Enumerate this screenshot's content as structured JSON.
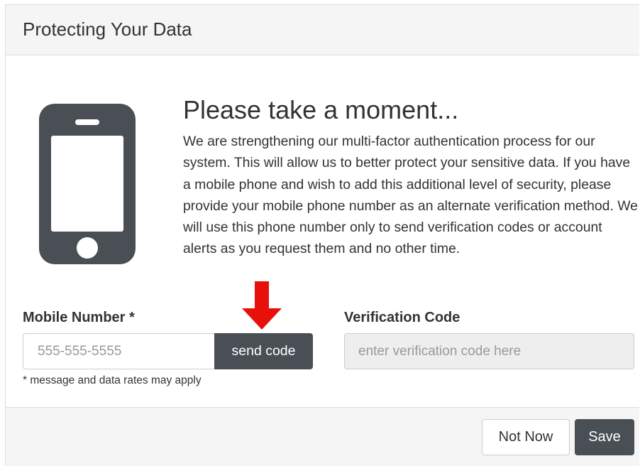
{
  "panel": {
    "title": "Protecting Your Data"
  },
  "content": {
    "icon": "mobile-phone-icon",
    "heading": "Please take a moment...",
    "body": "We are strengthening our multi-factor authentication process for our system. This will allow us to better protect your sensitive data. If you have a mobile phone and wish to add this additional level of security, please provide your mobile phone number as an alternate verification method. We will use this phone number only to send verification codes or account alerts as you request them and no other time."
  },
  "form": {
    "mobile_label": "Mobile Number *",
    "mobile_value": "",
    "mobile_placeholder": "555-555-5555",
    "send_code_label": "send code",
    "rates_note": "* message and data rates may apply",
    "verification_label": "Verification Code",
    "verification_value": "",
    "verification_placeholder": "enter verification code here",
    "annotation_icon": "red-down-arrow-icon"
  },
  "footer": {
    "not_now_label": "Not Now",
    "save_label": "Save"
  },
  "colors": {
    "dark_button": "#4a4f55",
    "panel_header_bg": "#f5f5f5",
    "disabled_input_bg": "#eeeeee",
    "arrow": "#e8100a"
  }
}
